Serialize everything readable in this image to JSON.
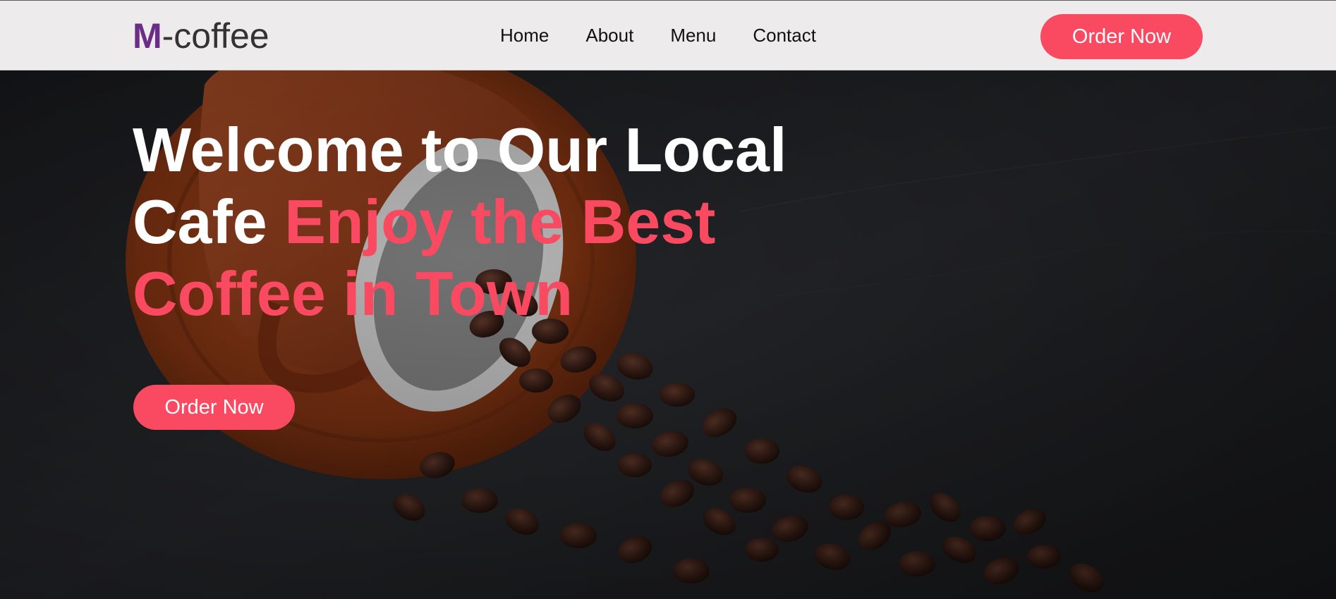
{
  "header": {
    "logo_mark": "M",
    "logo_text": "-coffee",
    "nav": [
      {
        "label": "Home"
      },
      {
        "label": "About"
      },
      {
        "label": "Menu"
      },
      {
        "label": "Contact"
      }
    ],
    "order_button": "Order Now"
  },
  "hero": {
    "title_white": "Welcome to Our Local Cafe",
    "title_accent": "Enjoy the Best Coffee in Town",
    "order_button": "Order Now",
    "background_image": "coffee cup with spilled coffee beans on dark stone"
  },
  "colors": {
    "accent": "#f94a62",
    "logo_mark": "#6a2e86",
    "header_bg": "#eeebec",
    "hero_bg": "#1b1c1e"
  }
}
